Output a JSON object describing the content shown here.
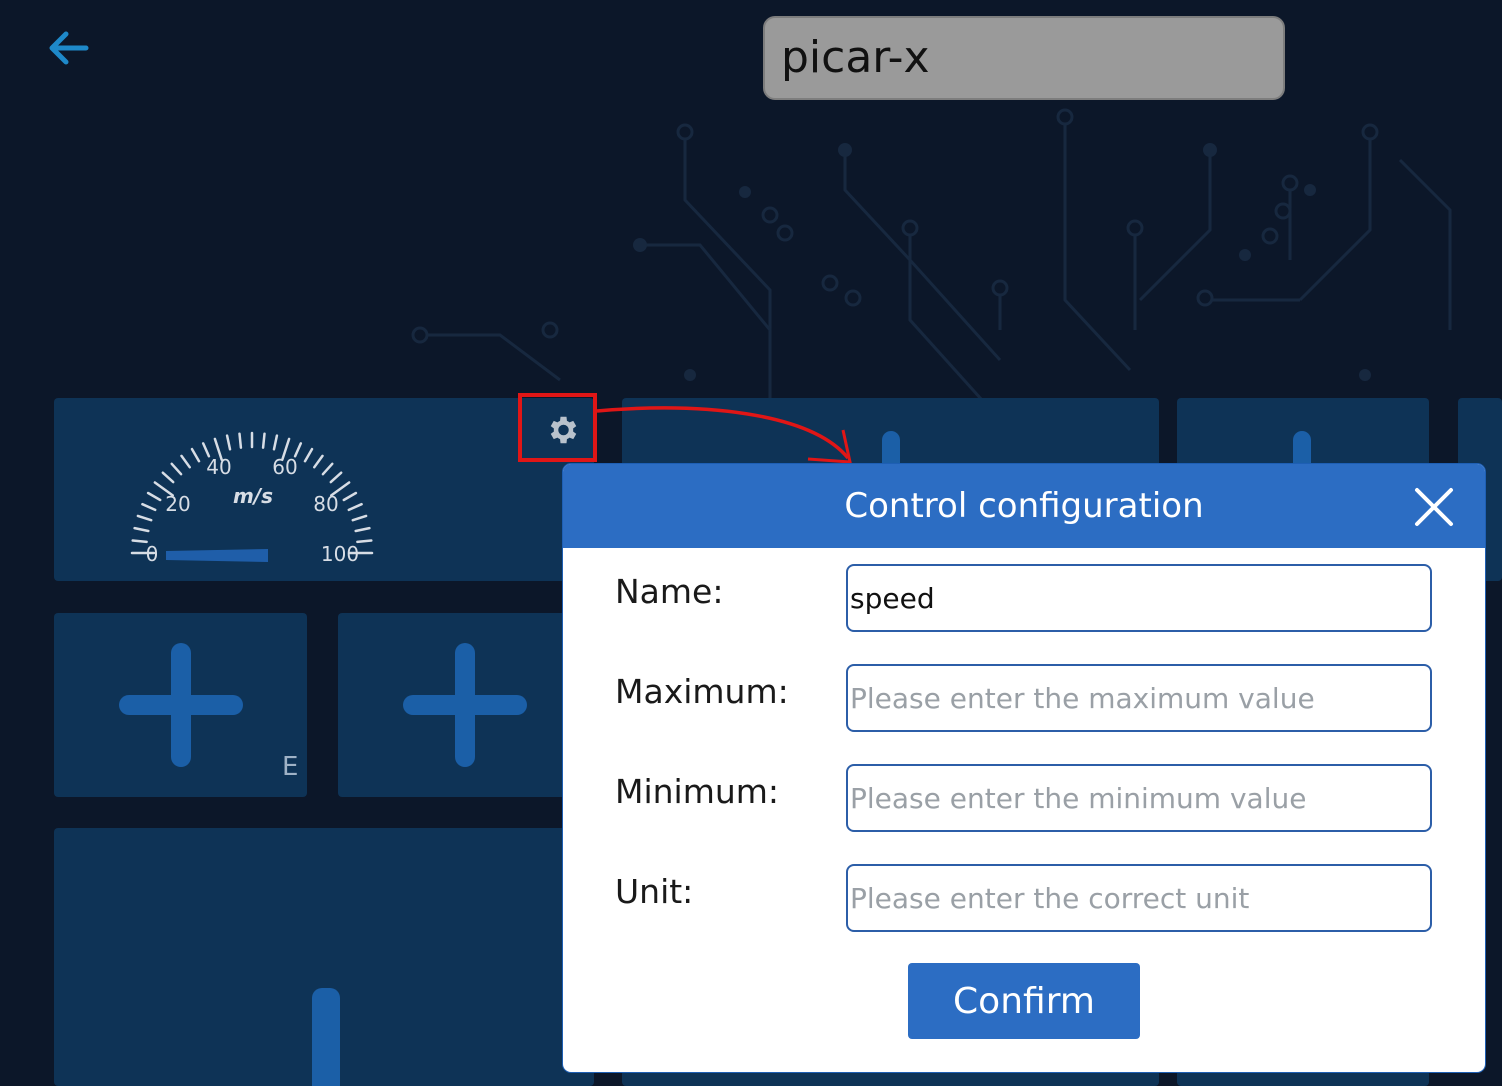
{
  "header": {
    "back_icon": "arrow-left-icon",
    "device_name": "picar-x"
  },
  "widgets": {
    "gauge": {
      "tick_labels": [
        "0",
        "20",
        "40",
        "60",
        "80",
        "100"
      ],
      "unit": "m/s"
    },
    "button_tile_label": "E",
    "settings_icon": "gear-icon"
  },
  "dialog": {
    "title": "Control configuration",
    "close_icon": "close-icon",
    "fields": {
      "name": {
        "label": "Name:",
        "value": "speed",
        "placeholder": ""
      },
      "maximum": {
        "label": "Maximum:",
        "value": "",
        "placeholder": "Please enter the maximum value"
      },
      "minimum": {
        "label": "Minimum:",
        "value": "",
        "placeholder": "Please enter the minimum value"
      },
      "unit": {
        "label": "Unit:",
        "value": "",
        "placeholder": "Please enter the correct unit"
      }
    },
    "confirm_label": "Confirm"
  },
  "colors": {
    "background": "#0c1729",
    "tile": "#0e3356",
    "accent": "#2c6dc3",
    "highlight": "#e01616"
  }
}
